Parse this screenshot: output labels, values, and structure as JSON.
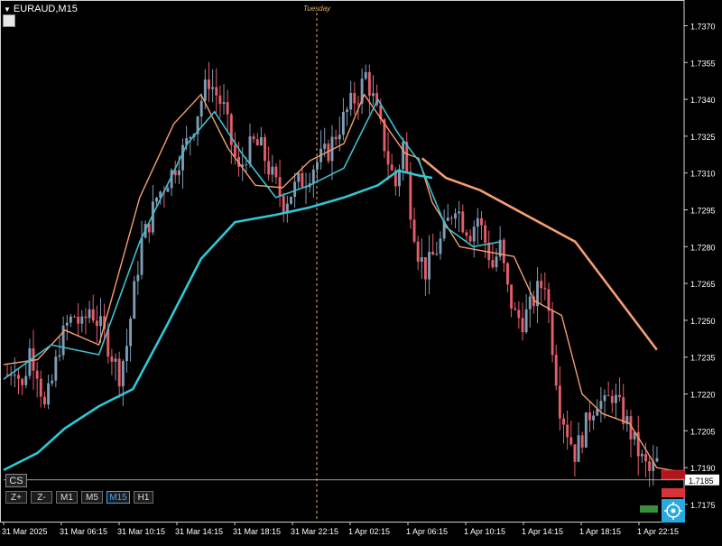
{
  "header": {
    "symbol": "EURAUD,M15",
    "day_separator_label": "Tuesday"
  },
  "buttons": {
    "cs": "CS",
    "zoom_in": "Z+",
    "zoom_out": "Z-",
    "timeframes": [
      "M1",
      "M5",
      "M15",
      "H1"
    ],
    "active_timeframe": "M15"
  },
  "colors": {
    "background": "#000000",
    "bull": "#7f9cb5",
    "bear": "#e35d6a",
    "fast_ma": "#f59e70",
    "slow_ma": "#2ec8d6",
    "mid_ma": "#3ec0d0",
    "axis_text": "#ffffff",
    "separator": "#e0b070",
    "price_tag": "#ffffff"
  },
  "chart_data": {
    "type": "candlestick",
    "title": "EURAUD,M15",
    "y_ticks": [
      1.7175,
      1.719,
      1.7205,
      1.722,
      1.7235,
      1.725,
      1.7265,
      1.728,
      1.7295,
      1.731,
      1.7325,
      1.734,
      1.7355,
      1.737
    ],
    "ylim": [
      1.7168,
      1.7379
    ],
    "x_ticks": [
      "31 Mar 2025",
      "31 Mar 06:15",
      "31 Mar 10:15",
      "31 Mar 14:15",
      "31 Mar 18:15",
      "31 Mar 22:15",
      "1 Apr 02:15",
      "1 Apr 06:15",
      "1 Apr 10:15",
      "1 Apr 14:15",
      "1 Apr 18:15",
      "1 Apr 22:15"
    ],
    "current_price": "1.7185",
    "close_path": [
      1.7228,
      1.7232,
      1.7222,
      1.7238,
      1.723,
      1.7214,
      1.7225,
      1.724,
      1.7248,
      1.7252,
      1.7247,
      1.7255,
      1.725,
      1.7244,
      1.7236,
      1.7228,
      1.724,
      1.7262,
      1.7282,
      1.729,
      1.73,
      1.7305,
      1.731,
      1.7316,
      1.7322,
      1.733,
      1.734,
      1.7348,
      1.7342,
      1.7336,
      1.7322,
      1.731,
      1.7318,
      1.7322,
      1.732,
      1.7312,
      1.7305,
      1.7298,
      1.7302,
      1.7306,
      1.7308,
      1.7313,
      1.7316,
      1.7319,
      1.7326,
      1.7332,
      1.7338,
      1.7342,
      1.735,
      1.734,
      1.7328,
      1.7315,
      1.7305,
      1.7322,
      1.7296,
      1.7278,
      1.727,
      1.7276,
      1.7282,
      1.729,
      1.7298,
      1.729,
      1.7286,
      1.7292,
      1.7282,
      1.7272,
      1.728,
      1.7262,
      1.7252,
      1.725,
      1.7255,
      1.7262,
      1.7266,
      1.724,
      1.7215,
      1.7205,
      1.7196,
      1.7203,
      1.7212,
      1.7218,
      1.7215,
      1.722,
      1.7214,
      1.7208,
      1.72,
      1.7193,
      1.7188,
      1.7192
    ],
    "fast_ma": [
      [
        0.0,
        1.7232
      ],
      [
        0.05,
        1.7234
      ],
      [
        0.09,
        1.7246
      ],
      [
        0.14,
        1.724
      ],
      [
        0.2,
        1.73
      ],
      [
        0.25,
        1.733
      ],
      [
        0.29,
        1.7342
      ],
      [
        0.33,
        1.732
      ],
      [
        0.37,
        1.7305
      ],
      [
        0.41,
        1.7304
      ],
      [
        0.45,
        1.7315
      ],
      [
        0.5,
        1.7322
      ],
      [
        0.53,
        1.7342
      ],
      [
        0.56,
        1.733
      ],
      [
        0.59,
        1.7318
      ],
      [
        0.61,
        1.7316
      ],
      [
        0.63,
        1.7298
      ],
      [
        0.67,
        1.728
      ],
      [
        0.71,
        1.7278
      ],
      [
        0.75,
        1.7276
      ],
      [
        0.78,
        1.7258
      ],
      [
        0.82,
        1.7252
      ],
      [
        0.85,
        1.722
      ],
      [
        0.88,
        1.7212
      ],
      [
        0.92,
        1.7208
      ],
      [
        0.96,
        1.719
      ],
      [
        1.0,
        1.7188
      ]
    ],
    "mid_ma": [
      [
        0.0,
        1.7226
      ],
      [
        0.07,
        1.724
      ],
      [
        0.14,
        1.7236
      ],
      [
        0.2,
        1.7282
      ],
      [
        0.27,
        1.7322
      ],
      [
        0.31,
        1.7335
      ],
      [
        0.35,
        1.7318
      ],
      [
        0.4,
        1.73
      ],
      [
        0.45,
        1.7305
      ],
      [
        0.5,
        1.7312
      ],
      [
        0.55,
        1.734
      ],
      [
        0.58,
        1.7326
      ],
      [
        0.61,
        1.7315
      ],
      [
        0.65,
        1.7288
      ],
      [
        0.69,
        1.728
      ],
      [
        0.73,
        1.7282
      ]
    ],
    "slow_ma": [
      [
        0.0,
        1.7189
      ],
      [
        0.05,
        1.7196
      ],
      [
        0.09,
        1.7206
      ],
      [
        0.14,
        1.7215
      ],
      [
        0.19,
        1.7222
      ],
      [
        0.24,
        1.7248
      ],
      [
        0.29,
        1.7275
      ],
      [
        0.34,
        1.729
      ],
      [
        0.4,
        1.7293
      ],
      [
        0.45,
        1.7296
      ],
      [
        0.5,
        1.73
      ],
      [
        0.55,
        1.7305
      ],
      [
        0.58,
        1.7311
      ],
      [
        0.61,
        1.7309
      ],
      [
        0.63,
        1.7308
      ]
    ],
    "orange_ma": [
      [
        0.615,
        1.7316
      ],
      [
        0.65,
        1.7308
      ],
      [
        0.7,
        1.7303
      ],
      [
        0.76,
        1.7294
      ],
      [
        0.84,
        1.7282
      ],
      [
        0.9,
        1.726
      ],
      [
        0.96,
        1.7238
      ]
    ]
  }
}
